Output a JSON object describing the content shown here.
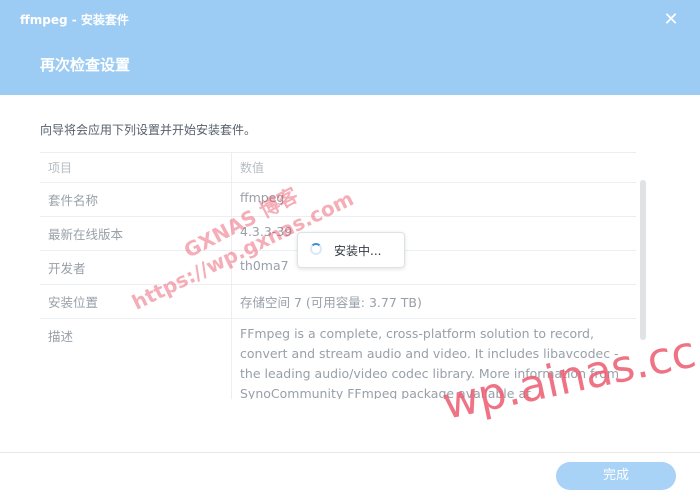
{
  "window": {
    "title": "ffmpeg - 安装套件",
    "close_symbol": "✕"
  },
  "page": {
    "title": "再次检查设置",
    "intro": "向导将会应用下列设置并开始安装套件。"
  },
  "table": {
    "headers": [
      "项目",
      "数值"
    ],
    "rows": [
      {
        "label": "套件名称",
        "value": "ffmpeg"
      },
      {
        "label": "最新在线版本",
        "value": "4.3.3-39"
      },
      {
        "label": "开发者",
        "value": "th0ma7"
      },
      {
        "label": "安装位置",
        "value": "存储空间 7 (可用容量: 3.77 TB)"
      },
      {
        "label": "描述",
        "value": "FFmpeg is a complete, cross-platform solution to record, convert and stream audio and video. It includes libavcodec - the leading audio/video codec library. More information from SynoCommunity FFmpeg package available at"
      }
    ]
  },
  "toast": {
    "text": "安装中..."
  },
  "footer": {
    "done_label": "完成"
  },
  "watermarks": {
    "line1": "GXNAS 博客",
    "line2": "https://wp.gxnas.com",
    "line3": "wp.ainas.cc"
  },
  "colors": {
    "header_bg": "#9ccbf3",
    "button_bg": "#a9d2f7",
    "spinner": "#3a8fd9",
    "watermark": "#e84a60"
  }
}
